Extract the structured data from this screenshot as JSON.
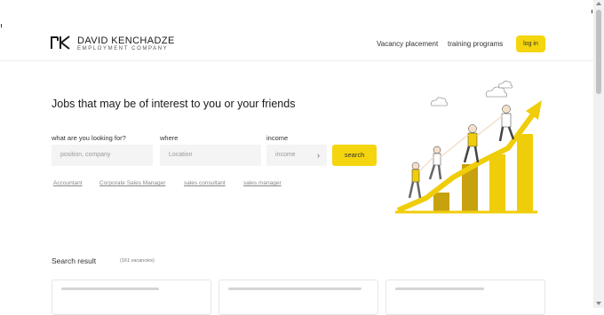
{
  "brand": {
    "name": "DAVID KENCHADZE",
    "subtitle": "EMPLOYMENT COMPANY"
  },
  "nav": {
    "items": [
      "Vacancy placement",
      "training programs"
    ],
    "login_label": "log in"
  },
  "hero": {
    "title": "Jobs that may be of interest to you or your friends",
    "labels": {
      "what": "what are you looking for?",
      "where": "where",
      "income": "income"
    },
    "placeholders": {
      "what": "position, company",
      "where": "Location",
      "income": "income"
    },
    "search_label": "search"
  },
  "tags": [
    "Accountant",
    "Corporate Sales Manager",
    "sales consultant",
    "sales manager"
  ],
  "results": {
    "title": "Search result",
    "count": "(161 vacancies)"
  },
  "colors": {
    "accent": "#f5d50e",
    "illustration_yellow": "#f0cd0a",
    "dark_bar": "#c7a10e"
  }
}
